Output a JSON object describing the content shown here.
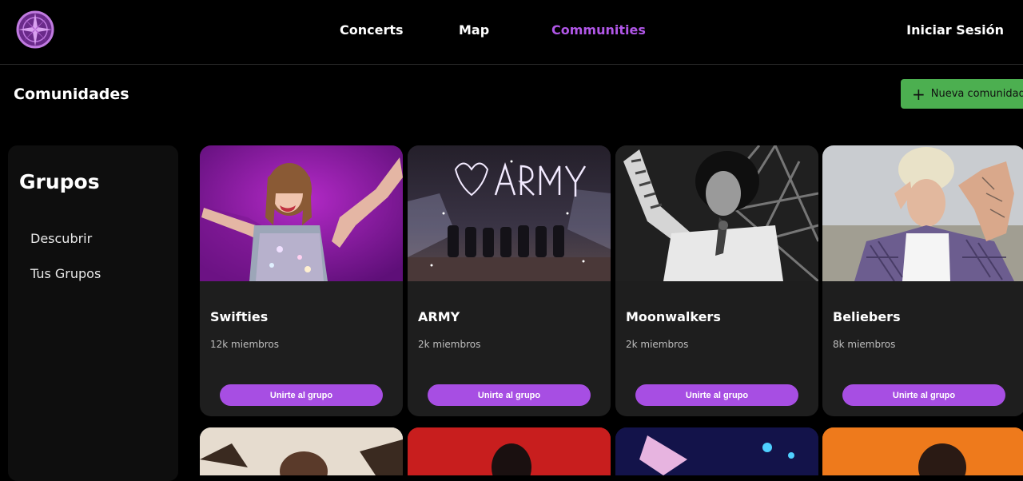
{
  "nav": {
    "items": [
      {
        "label": "Concerts"
      },
      {
        "label": "Map"
      },
      {
        "label": "Communities"
      }
    ],
    "login_label": "Iniciar Sesión"
  },
  "page": {
    "title": "Comunidades",
    "new_button_label": "Nueva comunidad"
  },
  "sidebar": {
    "title": "Grupos",
    "items": [
      {
        "label": "Descubrir"
      },
      {
        "label": "Tus Grupos"
      }
    ]
  },
  "cards": [
    {
      "name": "Swifties",
      "members": "12k miembros",
      "join_label": "Unirte al grupo"
    },
    {
      "name": "ARMY",
      "members": "2k miembros",
      "join_label": "Unirte al grupo"
    },
    {
      "name": "Moonwalkers",
      "members": "2k miembros",
      "join_label": "Unirte al grupo"
    },
    {
      "name": "Beliebers",
      "members": "8k miembros",
      "join_label": "Unirte al grupo"
    }
  ],
  "colors": {
    "accent": "#b157e8",
    "join_button": "#a74ee3",
    "new_button": "#4caf50",
    "card_bg": "#1e1e1e"
  }
}
